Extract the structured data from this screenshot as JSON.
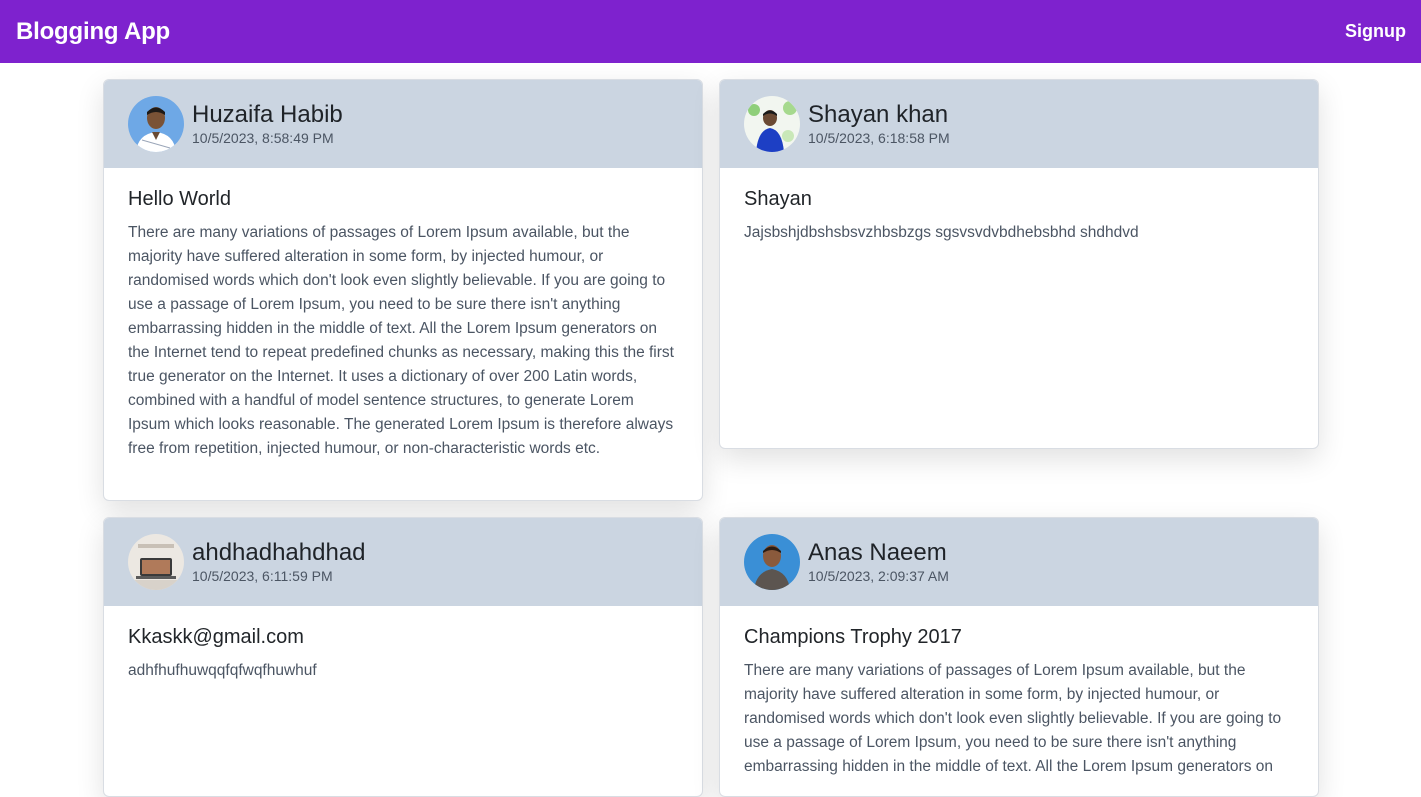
{
  "navbar": {
    "brand": "Blogging App",
    "signup_label": "Signup",
    "color": "#7e22ce"
  },
  "posts": [
    {
      "author": "Huzaifa Habib",
      "date": "10/5/2023, 8:58:49 PM",
      "title": "Hello World",
      "body": "There are many variations of passages of Lorem Ipsum available, but the majority have suffered alteration in some form, by injected humour, or randomised words which don't look even slightly believable. If you are going to use a passage of Lorem Ipsum, you need to be sure there isn't anything embarrassing hidden in the middle of text. All the Lorem Ipsum generators on the Internet tend to repeat predefined chunks as necessary, making this the first true generator on the Internet. It uses a dictionary of over 200 Latin words, combined with a handful of model sentence structures, to generate Lorem Ipsum which looks reasonable. The generated Lorem Ipsum is therefore always free from repetition, injected humour, or non-characteristic words etc."
    },
    {
      "author": "Shayan khan",
      "date": "10/5/2023, 6:18:58 PM",
      "title": "Shayan",
      "body": "Jajsbshjdbshsbsvzhbsbzgs sgsvsvdvbdhebsbhd shdhdvd"
    },
    {
      "author": "ahdhadhahdhad",
      "date": "10/5/2023, 6:11:59 PM",
      "title": "Kkaskk@gmail.com",
      "body": "adhfhufhuwqqfqfwqfhuwhuf"
    },
    {
      "author": "Anas Naeem",
      "date": "10/5/2023, 2:09:37 AM",
      "title": "Champions Trophy 2017",
      "body": "There are many variations of passages of Lorem Ipsum available, but the majority have suffered alteration in some form, by injected humour, or randomised words which don't look even slightly believable. If you are going to use a passage of Lorem Ipsum, you need to be sure there isn't anything embarrassing hidden in the middle of text. All the Lorem Ipsum generators on"
    }
  ]
}
